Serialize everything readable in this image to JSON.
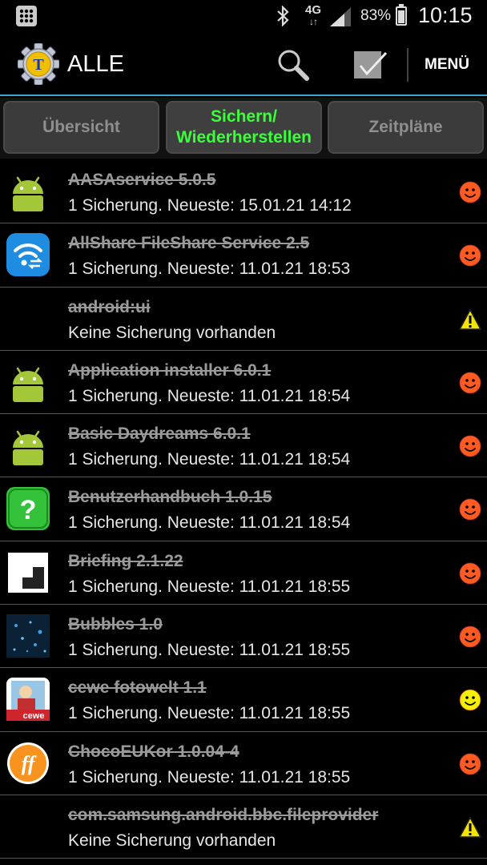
{
  "status_bar": {
    "bluetooth_icon": "bluetooth-icon",
    "network": "4G",
    "battery_percent": "83%",
    "battery_level": 0.83,
    "time": "10:15"
  },
  "action_bar": {
    "title": "ALLE",
    "menu_label": "MENÜ",
    "search_icon": "search-icon",
    "batch_icon": "checkbox-check-icon"
  },
  "tabs": [
    {
      "label": "Übersicht",
      "active": false
    },
    {
      "label": "Sichern/\nWiederherstellen",
      "active": true
    },
    {
      "label": "Zeitpläne",
      "active": false
    }
  ],
  "apps": [
    {
      "name": "AASAservice 5.0.5",
      "status": "1 Sicherung. Neueste: 15.01.21 14:12",
      "icon": "android-icon",
      "indicator": "red-smiley-icon"
    },
    {
      "name": "AllShare FileShare Service 2.5",
      "status": "1 Sicherung. Neueste: 11.01.21 18:53",
      "icon": "wifi-share-icon",
      "indicator": "red-smiley-icon"
    },
    {
      "name": "android:ui",
      "status": "Keine Sicherung vorhanden",
      "icon": "",
      "indicator": "warning-icon"
    },
    {
      "name": "Application installer 6.0.1",
      "status": "1 Sicherung. Neueste: 11.01.21 18:54",
      "icon": "android-icon",
      "indicator": "red-smiley-icon"
    },
    {
      "name": "Basic Daydreams 6.0.1",
      "status": "1 Sicherung. Neueste: 11.01.21 18:54",
      "icon": "android-icon",
      "indicator": "red-smiley-icon"
    },
    {
      "name": "Benutzerhandbuch 1.0.15",
      "status": "1 Sicherung. Neueste: 11.01.21 18:54",
      "icon": "help-question-icon",
      "indicator": "red-smiley-icon"
    },
    {
      "name": "Briefing 2.1.22",
      "status": "1 Sicherung. Neueste: 11.01.21 18:55",
      "icon": "flipboard-icon",
      "indicator": "red-smiley-icon"
    },
    {
      "name": "Bubbles 1.0",
      "status": "1 Sicherung. Neueste: 11.01.21 18:55",
      "icon": "bubbles-icon",
      "indicator": "red-smiley-icon"
    },
    {
      "name": "cewe fotowelt 1.1",
      "status": "1 Sicherung. Neueste: 11.01.21 18:55",
      "icon": "cewe-icon",
      "icon_text": "cewe",
      "indicator": "yellow-smiley-icon"
    },
    {
      "name": "ChocoEUKor 1.0.04-4",
      "status": "1 Sicherung. Neueste: 11.01.21 18:55",
      "icon": "ff-font-icon",
      "icon_text": "ff",
      "indicator": "red-smiley-icon"
    },
    {
      "name": "com.samsung.android.bbc.fileprovider",
      "status": "Keine Sicherung vorhanden",
      "icon": "",
      "indicator": "warning-icon"
    }
  ],
  "colors": {
    "accent_line": "#34a8d8",
    "active_tab_text": "#3aff3a",
    "smiley_red": "#ff5a1f",
    "smiley_yellow": "#f4f000",
    "android_green": "#a4c639"
  }
}
